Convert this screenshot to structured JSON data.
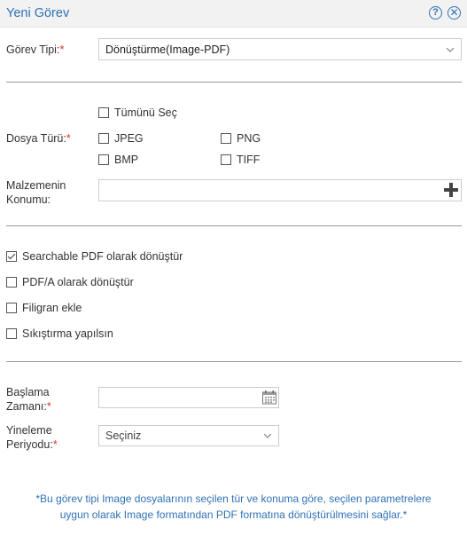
{
  "dialog": {
    "title": "Yeni Görev"
  },
  "task_type": {
    "label": "Görev Tipi:",
    "required": "*",
    "value": "Dönüştürme(Image-PDF)"
  },
  "file_type": {
    "label": "Dosya Türü:",
    "required": "*",
    "select_all": "Tümünü Seç",
    "options": [
      "JPEG",
      "PNG",
      "BMP",
      "TIFF"
    ]
  },
  "location": {
    "label_line1": "Malzemenin",
    "label_line2": "Konumu:",
    "value": ""
  },
  "conversion_options": [
    {
      "label": "Searchable PDF olarak dönüştür",
      "checked": true
    },
    {
      "label": "PDF/A olarak dönüştür",
      "checked": false
    },
    {
      "label": "Filigran ekle",
      "checked": false
    },
    {
      "label": "Sıkıştırma yapılsın",
      "checked": false
    }
  ],
  "start_time": {
    "label_line1": "Başlama",
    "label_line2": "Zamanı:",
    "required": "*",
    "value": ""
  },
  "repeat_period": {
    "label_line1": "Yineleme",
    "label_line2": "Periyodu:",
    "required": "*",
    "value": "Seçiniz"
  },
  "note": {
    "line1": "*Bu görev tipi Image dosyalarının seçilen tür ve konuma göre, seçilen parametrelere",
    "line2": "uygun olarak Image formatından PDF formatına dönüştürülmesini sağlar.*"
  },
  "colors": {
    "accent": "#2f72b5",
    "required": "#e03030",
    "border": "#cccccc",
    "divider": "#999999"
  }
}
